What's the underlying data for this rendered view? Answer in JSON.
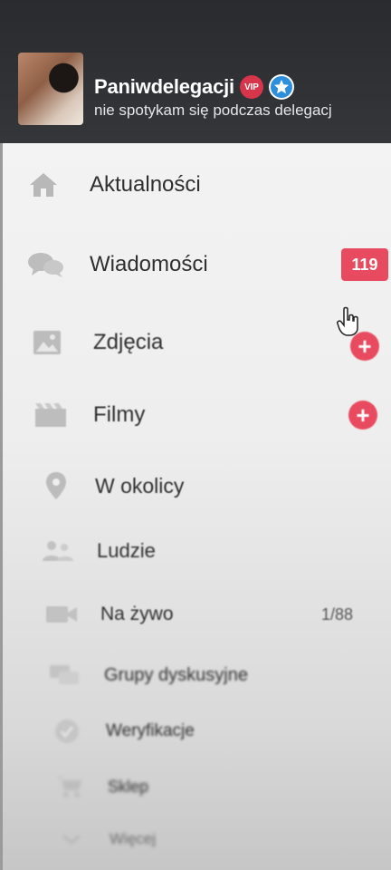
{
  "profile": {
    "username": "Paniwdelegacji",
    "vip_badge": "VIP",
    "status": "nie spotykam się podczas delegacj"
  },
  "menu": {
    "items": [
      {
        "label": "Aktualności",
        "icon": "home-icon"
      },
      {
        "label": "Wiadomości",
        "icon": "chat-bubbles-icon",
        "badge": "119"
      },
      {
        "label": "Zdjęcia",
        "icon": "image-icon",
        "action": "+"
      },
      {
        "label": "Filmy",
        "icon": "film-icon",
        "action": "+"
      },
      {
        "label": "W okolicy",
        "icon": "location-pin-icon"
      },
      {
        "label": "Ludzie",
        "icon": "people-icon"
      },
      {
        "label": "Na żywo",
        "icon": "video-camera-icon",
        "count": "1/88"
      },
      {
        "label": "Grupy dyskusyjne",
        "icon": "discussion-icon"
      },
      {
        "label": "Weryfikacje",
        "icon": "check-circle-icon"
      },
      {
        "label": "Sklep",
        "icon": "cart-icon"
      },
      {
        "label": "Więcej",
        "icon": "chevron-down-icon"
      }
    ]
  },
  "colors": {
    "header_bg": "#2f3033",
    "menu_bg": "#f0f0f0",
    "accent": "#e84a5f",
    "icon_gray": "#b5b5b5",
    "text": "#2f2f2f"
  }
}
